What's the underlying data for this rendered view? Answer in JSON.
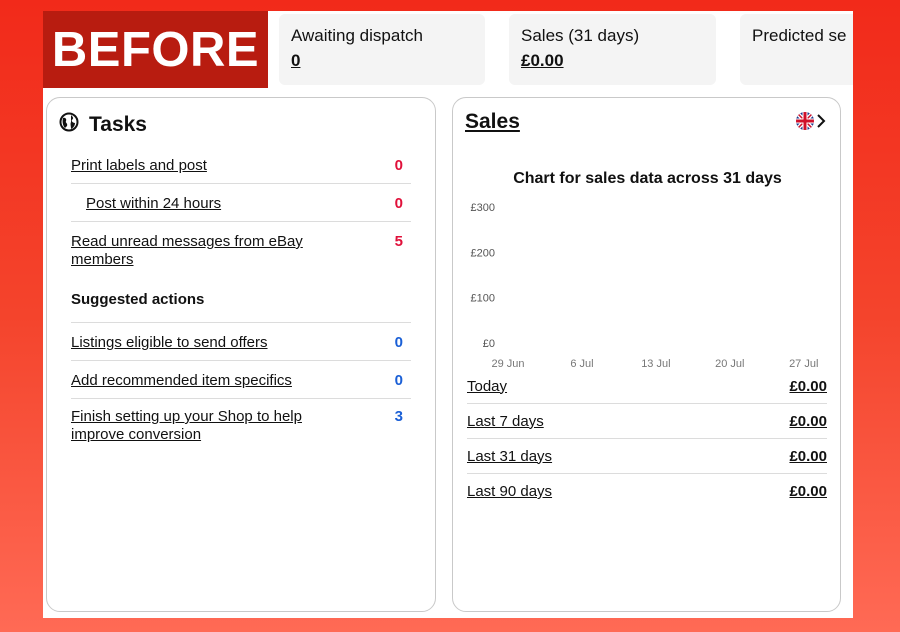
{
  "badge": {
    "text": "BEFORE"
  },
  "stats": [
    {
      "label": "Awaiting dispatch",
      "value": "0"
    },
    {
      "label": "Sales (31 days)",
      "value": "£0.00"
    },
    {
      "label": "Predicted se",
      "value": ""
    }
  ],
  "tasks": {
    "title": "Tasks",
    "icon": "globe-icon",
    "items": [
      {
        "label": "Print labels and post",
        "count": "0"
      },
      {
        "label": "Post within 24 hours",
        "count": "0"
      },
      {
        "label": "Read unread messages from eBay members",
        "count": "5"
      }
    ],
    "suggested_heading": "Suggested actions",
    "suggested": [
      {
        "label": "Listings eligible to send offers",
        "count": "0"
      },
      {
        "label": "Add recommended item specifics",
        "count": "0"
      },
      {
        "label": "Finish setting up your Shop to help improve conversion",
        "count": "3"
      }
    ],
    "colors": {
      "alert": "#e0103a",
      "info": "#1a5fd6"
    }
  },
  "sales": {
    "title": "Sales",
    "flag_icon": "uk-flag-icon",
    "nav_icon": "chevron-right-icon",
    "periods": [
      {
        "label": "Today",
        "value": "£0.00"
      },
      {
        "label": "Last 7 days",
        "value": "£0.00"
      },
      {
        "label": "Last 31 days",
        "value": "£0.00"
      },
      {
        "label": "Last 90 days",
        "value": "£0.00"
      }
    ]
  },
  "chart_data": {
    "type": "bar",
    "title": "Chart for sales data across 31 days",
    "y_ticks": [
      "£300",
      "£200",
      "£100",
      "£0"
    ],
    "y_tick_values": [
      300,
      200,
      100,
      0
    ],
    "x_ticks": [
      "29 Jun",
      "6 Jul",
      "13 Jul",
      "20 Jul",
      "27 Jul"
    ],
    "ylim": [
      0,
      300
    ],
    "grid": false,
    "series": [
      {
        "values": [
          0,
          0,
          0,
          0,
          0
        ]
      }
    ]
  }
}
